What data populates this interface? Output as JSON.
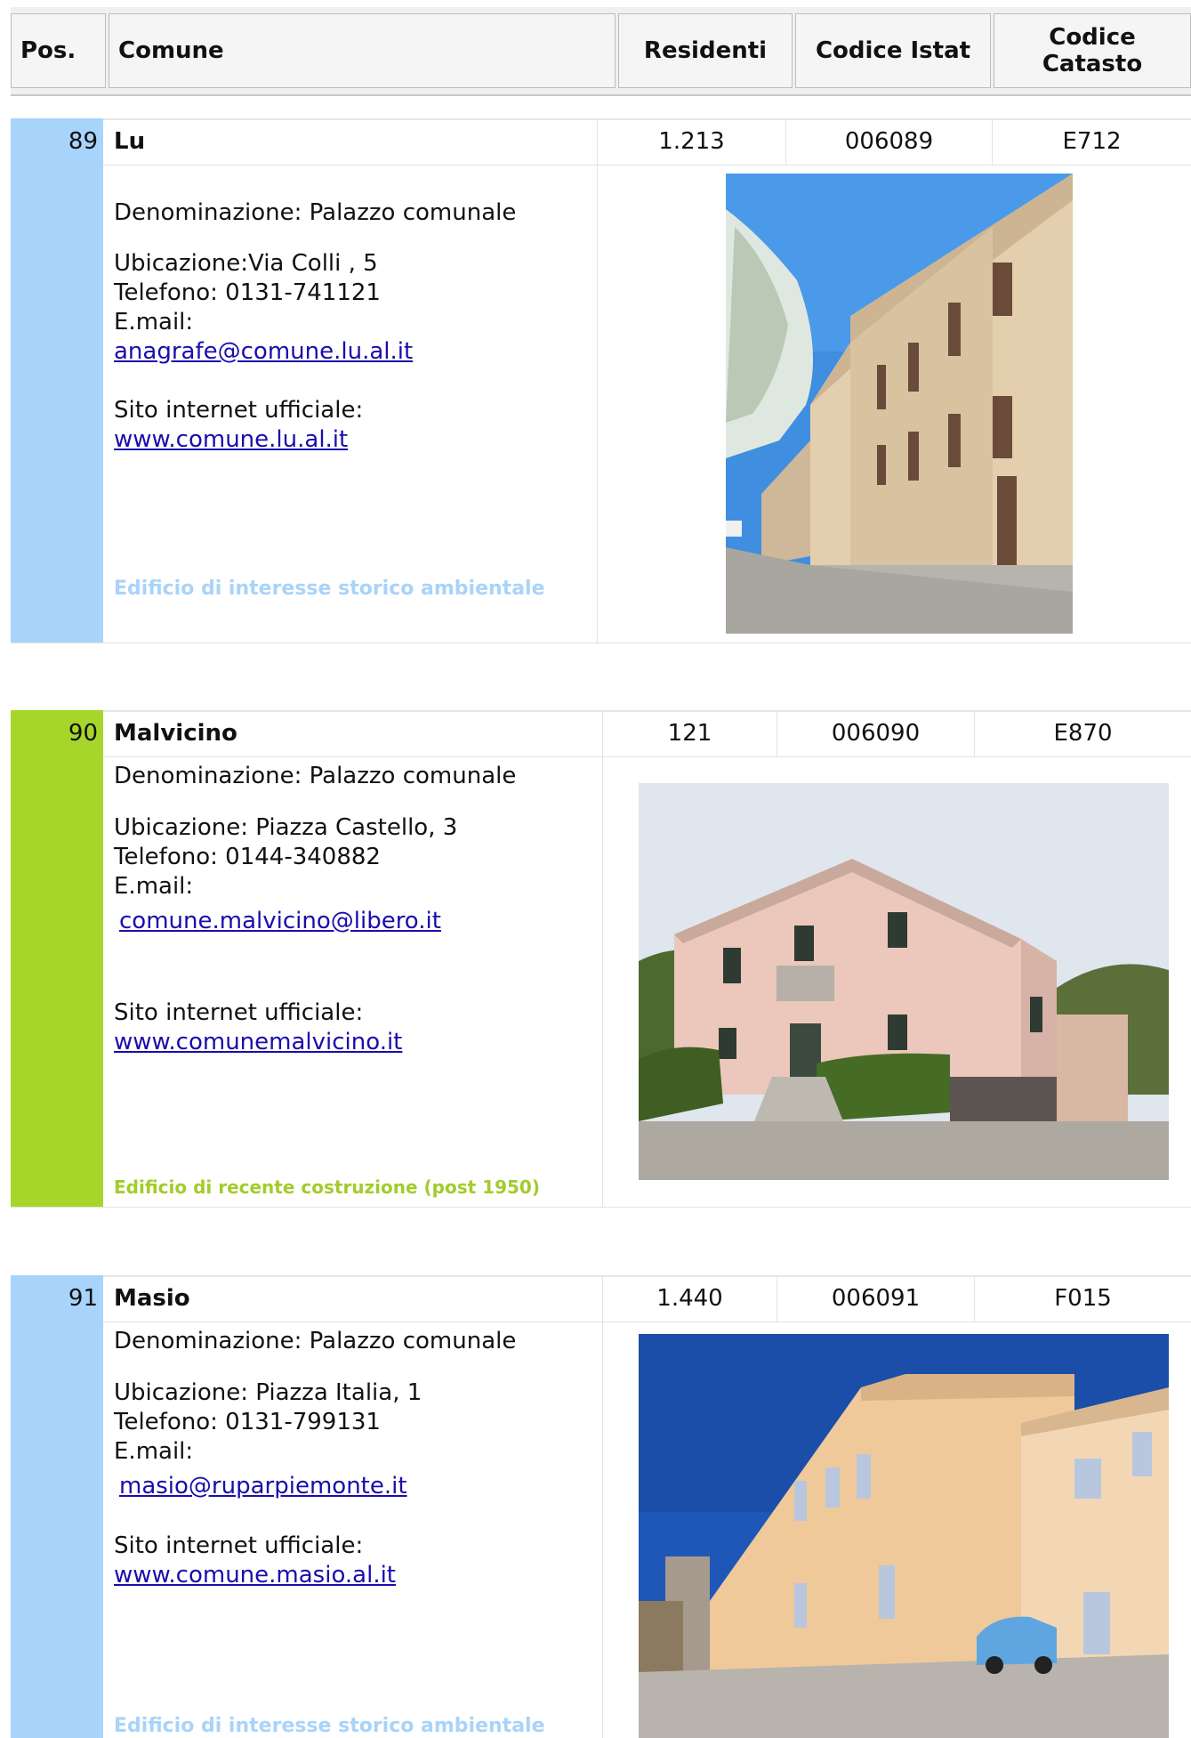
{
  "header": {
    "pos": "Pos.",
    "comune": "Comune",
    "residenti": "Residenti",
    "istat": "Codice Istat",
    "catasto": "Codice Catasto"
  },
  "records": [
    {
      "pos": "89",
      "name": "Lu",
      "residenti": "1.213",
      "istat": "006089",
      "catasto": "E712",
      "denominazione": "Denominazione: Palazzo comunale",
      "ubicazione": "Ubicazione:Via Colli , 5",
      "telefono": "Telefono: 0131-741121",
      "email_label": "E.mail:",
      "email": "anagrafe@comune.lu.al.it",
      "sito_label": "Sito internet ufficiale:",
      "sito": "www.comune.lu.al.it",
      "category": "Edificio di interesse storico ambientale",
      "side_color": "#a8d4fb",
      "category_color": "#a9d3f9"
    },
    {
      "pos": "90",
      "name": "Malvicino",
      "residenti": "121",
      "istat": "006090",
      "catasto": "E870",
      "denominazione": "Denominazione: Palazzo comunale",
      "ubicazione": "Ubicazione: Piazza Castello, 3",
      "telefono": "Telefono: 0144-340882",
      "email_label": "E.mail:",
      "email": "comune.malvicino@libero.it",
      "sito_label": "Sito internet ufficiale:",
      "sito": "www.comunemalvicino.it",
      "category": "Edificio di recente costruzione (post 1950)",
      "side_color": "#a6d62a",
      "category_color": "#a2cc2b"
    },
    {
      "pos": "91",
      "name": "Masio",
      "residenti": "1.440",
      "istat": "006091",
      "catasto": "F015",
      "denominazione": "Denominazione: Palazzo comunale",
      "ubicazione": "Ubicazione: Piazza Italia, 1",
      "telefono": "Telefono: 0131-799131",
      "email_label": "E.mail:",
      "email": "masio@ruparpiemonte.it",
      "sito_label": "Sito internet ufficiale:",
      "sito": "www.comune.masio.al.it",
      "category": "Edificio di interesse storico ambientale",
      "side_color": "#a8d4fb",
      "category_color": "#a9d3f9"
    }
  ]
}
